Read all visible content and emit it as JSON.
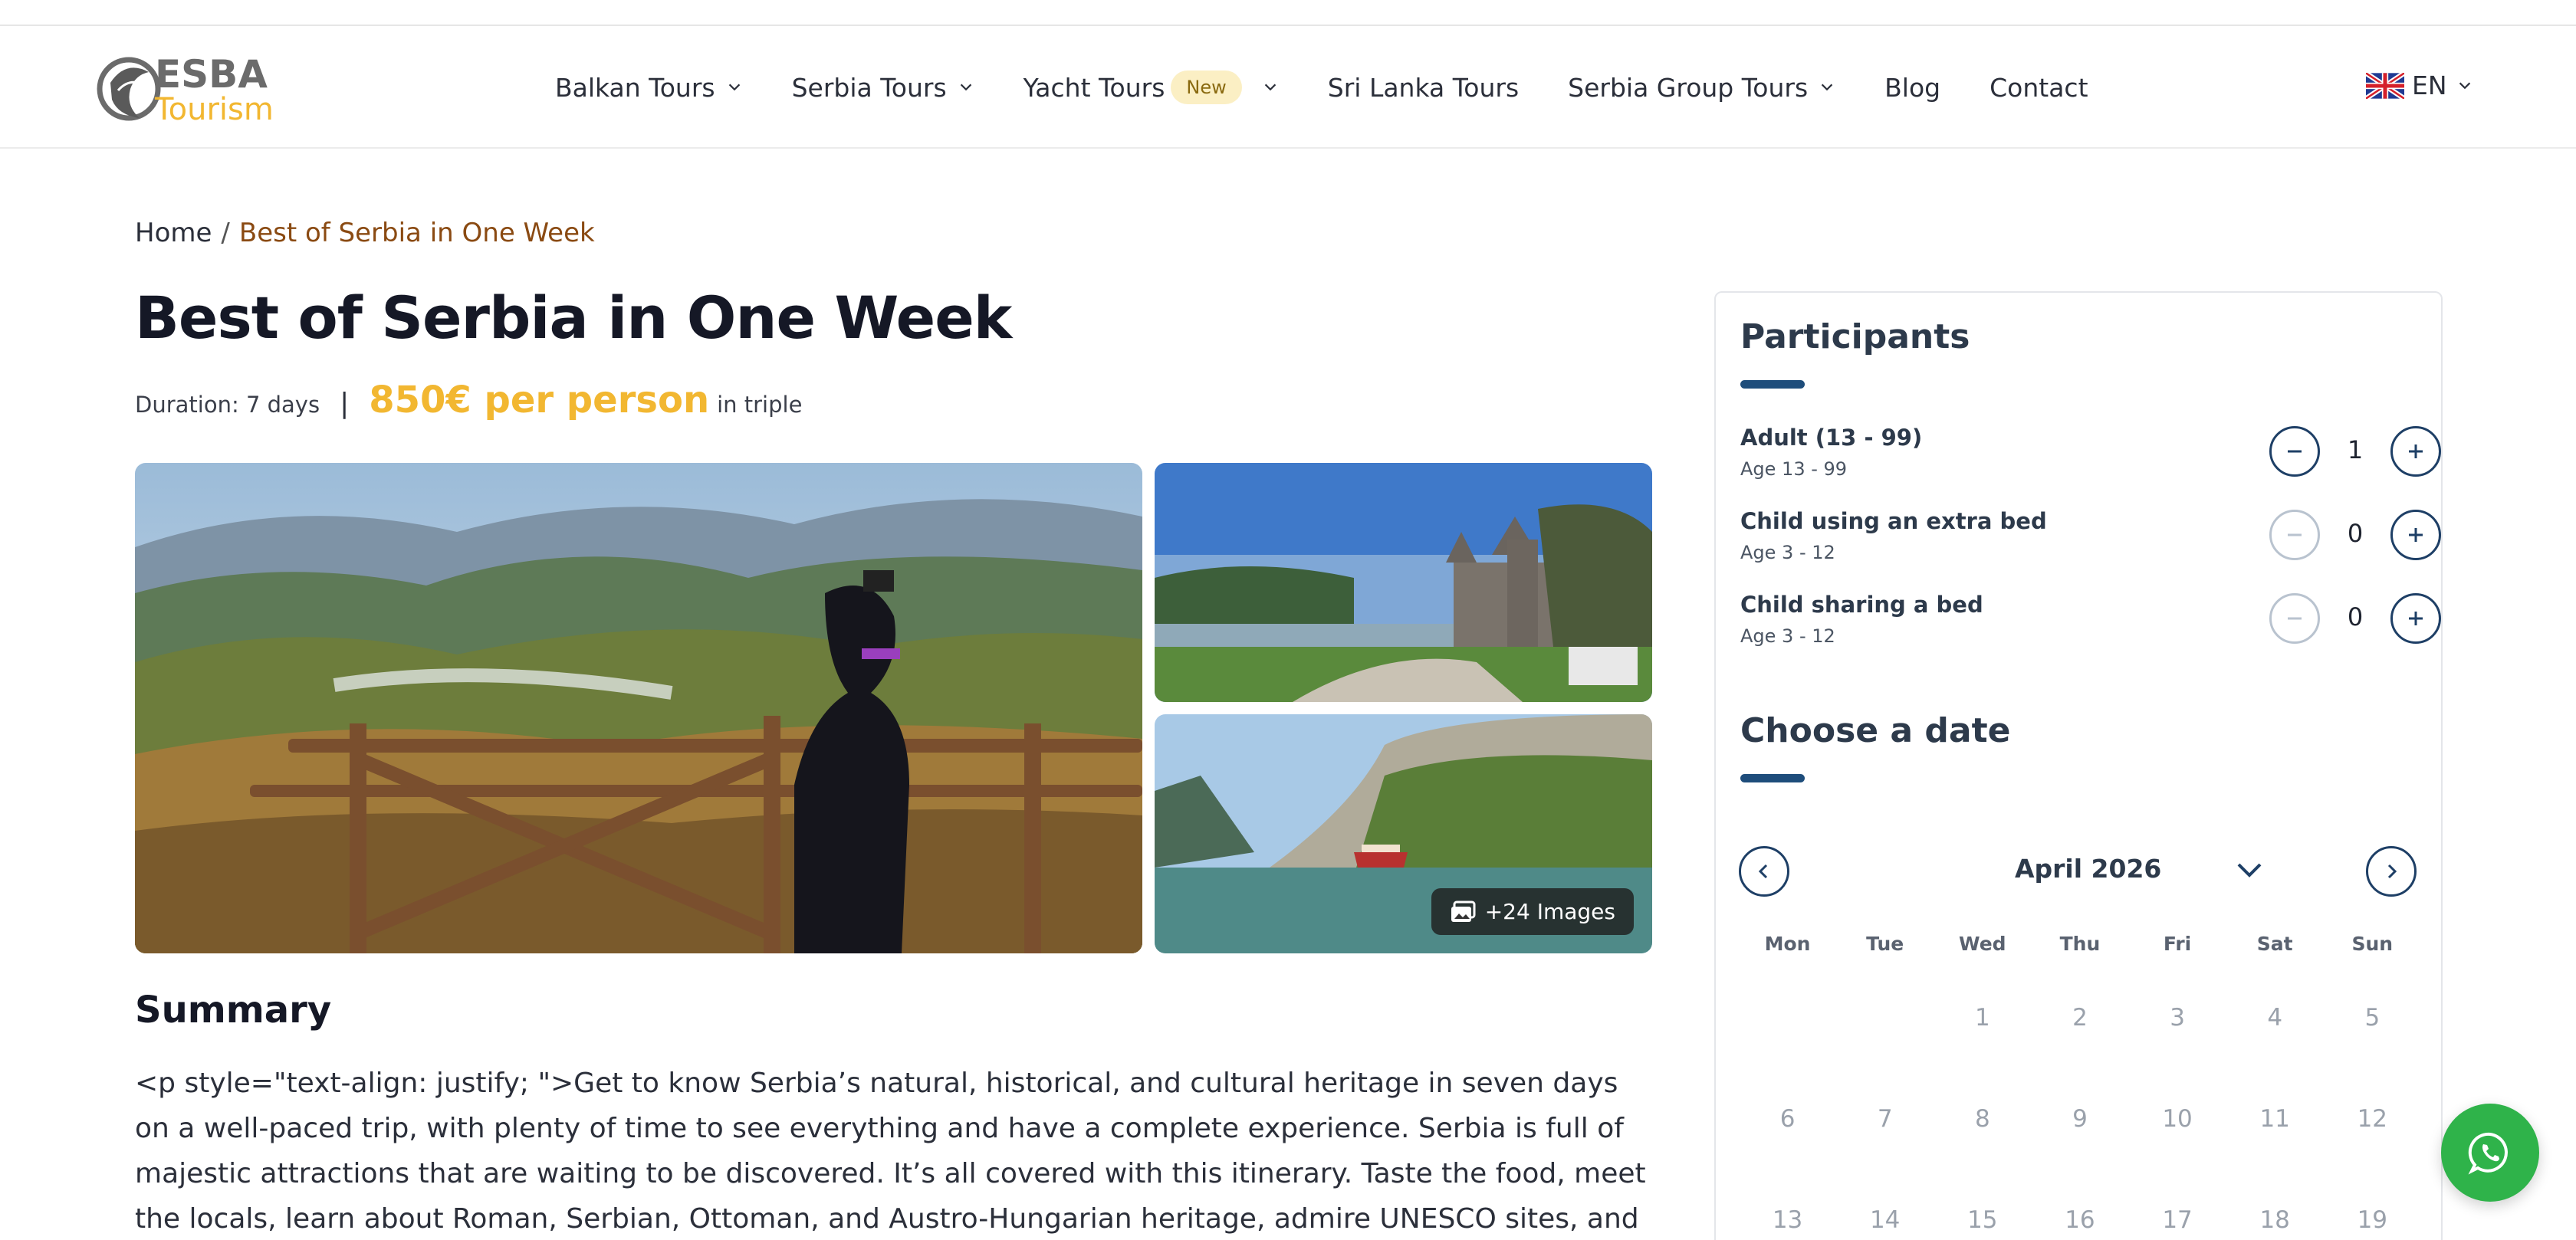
{
  "header": {
    "logo_text_top": "ESBA",
    "logo_text_bottom": "Tourism",
    "nav": [
      {
        "label": "Balkan Tours",
        "has_dropdown": true
      },
      {
        "label": "Serbia Tours",
        "has_dropdown": true
      },
      {
        "label": "Yacht Tours",
        "badge": "New",
        "has_dropdown": true
      },
      {
        "label": "Sri Lanka Tours",
        "has_dropdown": false
      },
      {
        "label": "Serbia Group Tours",
        "has_dropdown": true
      },
      {
        "label": "Blog",
        "has_dropdown": false
      },
      {
        "label": "Contact",
        "has_dropdown": false
      }
    ],
    "language": "EN"
  },
  "breadcrumb": {
    "home": "Home",
    "separator": "/",
    "current": "Best of Serbia in One Week"
  },
  "tour": {
    "title": "Best of Serbia in One Week",
    "duration": "Duration: 7 days",
    "pipe": "|",
    "price": "850€ per person",
    "price_note": "in triple",
    "more_images": "+24 Images"
  },
  "summary": {
    "heading": "Summary",
    "text": "<p style=\"text-align: justify; \">Get to know Serbia’s natural, historical, and cultural heritage in seven days on a well-paced trip, with plenty of time to see everything and have a complete experience. Serbia is full of majestic attractions that are waiting to be discovered. It’s all covered with this itinerary. Taste the food, meet the locals, learn about Roman, Serbian, Ottoman, and Austro-Hungarian heritage, admire UNESCO sites, and"
  },
  "booking": {
    "participants_heading": "Participants",
    "participants": [
      {
        "name": "Adult (13 - 99)",
        "age": "Age 13 - 99",
        "count": "1",
        "minus_enabled": true
      },
      {
        "name": "Child using an extra bed",
        "age": "Age 3 - 12",
        "count": "0",
        "minus_enabled": false
      },
      {
        "name": "Child sharing a bed",
        "age": "Age 3 - 12",
        "count": "0",
        "minus_enabled": false
      }
    ],
    "date_heading": "Choose a date",
    "calendar": {
      "month": "April 2026",
      "weekdays": [
        "Mon",
        "Tue",
        "Wed",
        "Thu",
        "Fri",
        "Sat",
        "Sun"
      ],
      "weeks": [
        [
          "",
          "",
          "1",
          "2",
          "3",
          "4",
          "5"
        ],
        [
          "6",
          "7",
          "8",
          "9",
          "10",
          "11",
          "12"
        ],
        [
          "13",
          "14",
          "15",
          "16",
          "17",
          "18",
          "19"
        ]
      ]
    }
  },
  "colors": {
    "price": "#f2b731",
    "breadcrumb_current": "#8a4a12",
    "accent_navy": "#1e4d7b",
    "whatsapp": "#2fb34a"
  },
  "icons": {
    "whatsapp": "whatsapp-icon",
    "images": "image-stack-icon",
    "chevron": "chevron-down-icon"
  }
}
